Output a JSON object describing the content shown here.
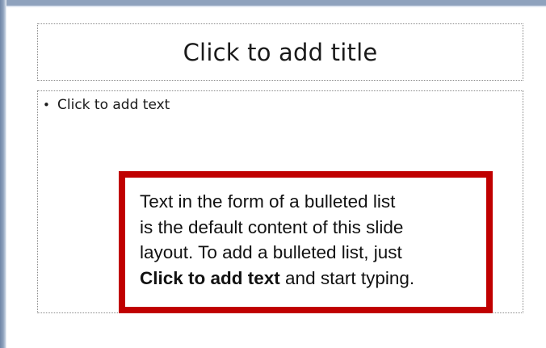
{
  "slide": {
    "title_placeholder": "Click to add title",
    "body_placeholder": {
      "bullet": "•",
      "text": "Click to add text"
    }
  },
  "callout": {
    "line1": "Text in the form of a bulleted list",
    "line2": "is the default content of this slide",
    "line3": "layout. To add a bulleted list, just",
    "line4_bold": "Click to add text",
    "line4_rest": " and start typing."
  },
  "colors": {
    "callout_border": "#c00000",
    "frame": "#8fa2bd"
  }
}
